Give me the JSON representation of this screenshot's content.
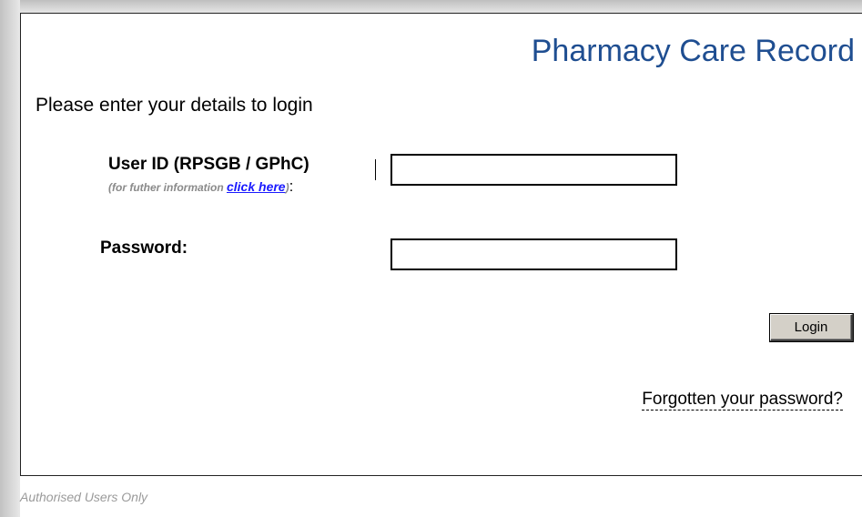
{
  "header": {
    "title": "Pharmacy Care Record"
  },
  "login_form": {
    "intro": "Please enter your details to login",
    "user_id": {
      "label": "User ID (RPSGB / GPhC)",
      "help_prefix": "(for futher information ",
      "help_link": "click here",
      "help_suffix": ")",
      "colon": ":",
      "value": ""
    },
    "password": {
      "label": "Password:",
      "value": ""
    },
    "login_button": "Login",
    "forgot_link": "Forgotten your password?"
  },
  "footer": {
    "notice": "Authorised Users Only"
  },
  "colors": {
    "title": "#1f4e91",
    "link": "#1a1aff",
    "button_face": "#d4d0c8",
    "muted_text": "#8a8a8a"
  }
}
